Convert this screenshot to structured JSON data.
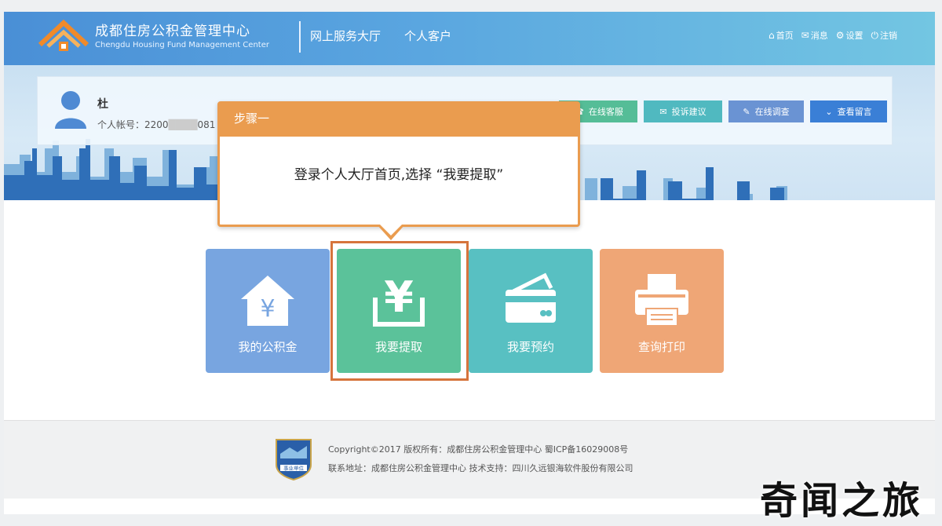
{
  "header": {
    "brand_cn": "成都住房公积金管理中心",
    "brand_en": "Chengdu Housing Fund Management Center",
    "nav": [
      "网上服务大厅",
      "个人客户"
    ],
    "links": [
      {
        "label": "首页",
        "icon": "home-icon"
      },
      {
        "label": "消息",
        "icon": "mail-icon"
      },
      {
        "label": "设置",
        "icon": "gear-icon"
      },
      {
        "label": "注销",
        "icon": "logout-icon"
      }
    ]
  },
  "user": {
    "name": "杜",
    "account": "个人帐号：2200",
    "account_tail": "081"
  },
  "actions": {
    "service": "在线客服",
    "complaint": "投诉建议",
    "survey": "在线调查",
    "messages": "查看留言"
  },
  "callout": {
    "title": "步骤一",
    "text": "登录个人大厅首页,选择 “我要提取”"
  },
  "tiles": [
    {
      "label": "我的公积金",
      "icon": "house-yuan-icon",
      "color": "#78a5e0"
    },
    {
      "label": "我要提取",
      "icon": "yuan-withdraw-icon",
      "color": "#5bc29a"
    },
    {
      "label": "我要预约",
      "icon": "card-icon",
      "color": "#58c0c2"
    },
    {
      "label": "查询打印",
      "icon": "printer-icon",
      "color": "#efa676"
    }
  ],
  "footer": {
    "copyright": "Copyright©2017 版权所有：成都住房公积金管理中心 蜀ICP备16029008号",
    "address": "联系地址：成都住房公积金管理中心 技术支持：四川久远银海软件股份有限公司",
    "seal_text": "事业单位"
  },
  "watermark": "奇闻之旅",
  "colors": {
    "header_start": "#4a8fd6",
    "header_end": "#73c6e2",
    "callout": "#ea9c4f",
    "highlight": "#d6743c"
  }
}
